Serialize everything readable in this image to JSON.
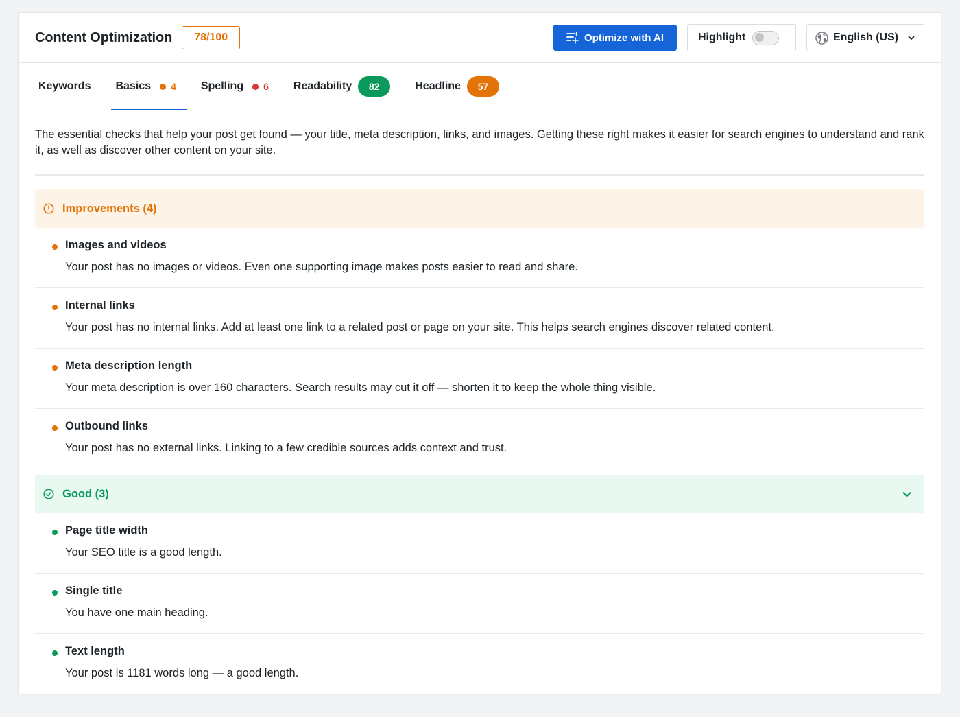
{
  "header": {
    "title": "Content Optimization",
    "score": "78/100",
    "optimize_label": "Optimize with AI",
    "highlight_label": "Highlight",
    "language_label": "English (US)"
  },
  "tabs": [
    {
      "label": "Keywords"
    },
    {
      "label": "Basics",
      "count": "4",
      "dot_color": "#e37306"
    },
    {
      "label": "Spelling",
      "count": "6",
      "dot_color": "#d63638"
    },
    {
      "label": "Readability",
      "score": "82",
      "score_color": "#0a9a5b"
    },
    {
      "label": "Headline",
      "score": "57",
      "score_color": "#e37306"
    }
  ],
  "intro": "The essential checks that help your post get found — your title, meta description, links, and images. Getting these right makes it easier for search engines to understand and rank it, as well as discover other content on your site.",
  "improvements": {
    "label": "Improvements (4)",
    "color": "#e37306",
    "items": [
      {
        "title": "Images and videos",
        "desc": "Your post has no images or videos. Even one supporting image makes posts easier to read and share."
      },
      {
        "title": "Internal links",
        "desc": "Your post has no internal links. Add at least one link to a related post or page on your site. This helps search engines discover related content."
      },
      {
        "title": "Meta description length",
        "desc": "Your meta description is over 160 characters. Search results may cut it off — shorten it to keep the whole thing visible."
      },
      {
        "title": "Outbound links",
        "desc": "Your post has no external links. Linking to a few credible sources adds context and trust."
      }
    ]
  },
  "good": {
    "label": "Good (3)",
    "color": "#0a9a5b",
    "items": [
      {
        "title": "Page title width",
        "desc": "Your SEO title is a good length."
      },
      {
        "title": "Single title",
        "desc": "You have one main heading."
      },
      {
        "title": "Text length",
        "desc": "Your post is 1181 words long — a good length."
      }
    ]
  },
  "icons": {
    "ai": "sparkle-list-icon",
    "language": "globe-icon",
    "dropdown": "chevron-down-icon",
    "improvements": "alert-circle-icon",
    "good": "check-circle-icon"
  },
  "colors": {
    "accent": "#1565d8",
    "warning": "#e37306",
    "error": "#d63638",
    "success": "#0a9a5b"
  }
}
